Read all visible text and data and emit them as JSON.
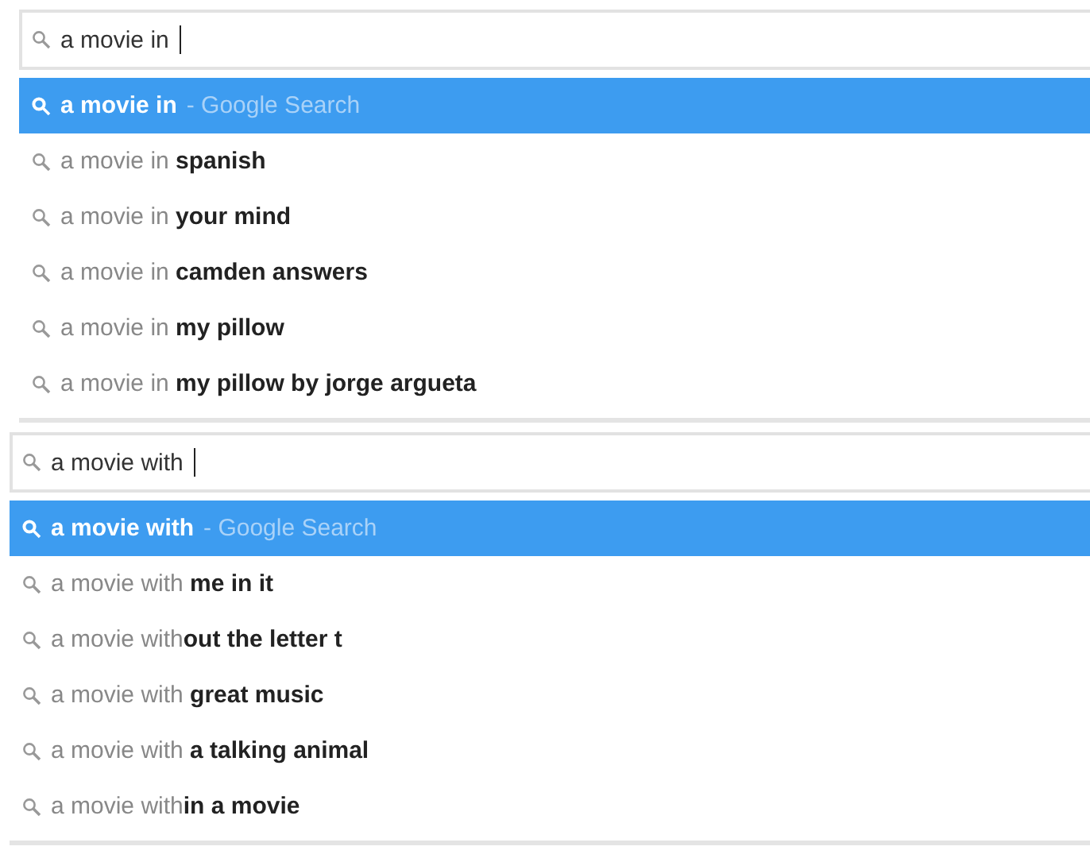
{
  "panels": [
    {
      "search": {
        "value": "a movie in"
      },
      "suggestions": [
        {
          "text": "a movie in",
          "hint": "- Google Search",
          "selected": true
        },
        {
          "text": "a movie in **spanish**",
          "selected": false
        },
        {
          "text": "a movie in **your mind**",
          "selected": false
        },
        {
          "text": "a movie in **camden answers**",
          "selected": false
        },
        {
          "text": "a movie in **my pillow**",
          "selected": false
        },
        {
          "text": "a movie in **my pillow by jorge argueta**",
          "selected": false
        }
      ]
    },
    {
      "search": {
        "value": "a movie with"
      },
      "suggestions": [
        {
          "text": "a movie with",
          "hint": "- Google Search",
          "selected": true
        },
        {
          "text": "a movie with **me in it**",
          "selected": false
        },
        {
          "text": "a movie with**out the letter t**",
          "selected": false
        },
        {
          "text": "a movie with **great music**",
          "selected": false
        },
        {
          "text": "a movie with **a talking animal**",
          "selected": false
        },
        {
          "text": "a movie with**in a movie**",
          "selected": false
        }
      ]
    }
  ]
}
